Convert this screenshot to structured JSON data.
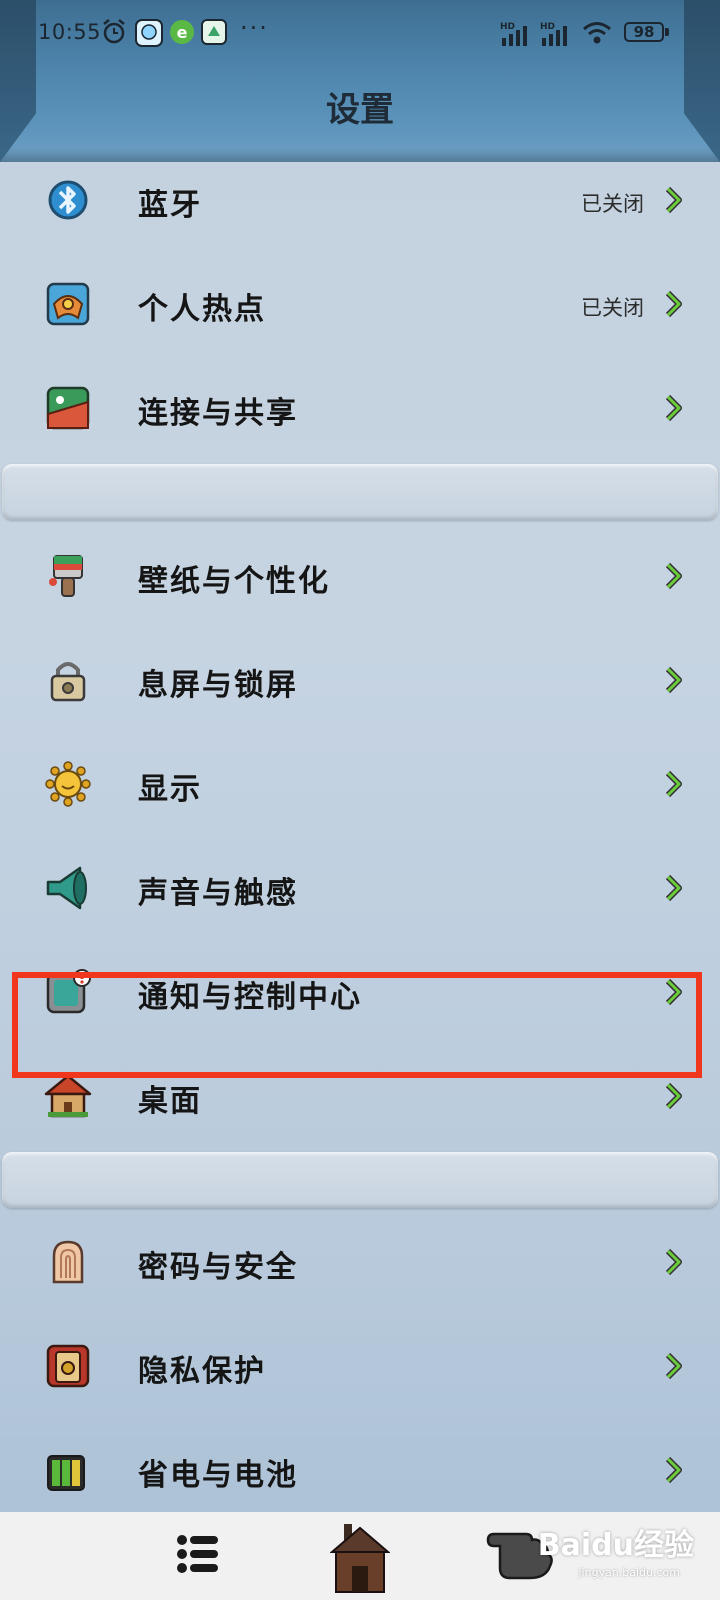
{
  "status_bar": {
    "time": "10:55",
    "icons": [
      "alarm-icon",
      "chat-app-icon",
      "e-app-icon",
      "app-notification-icon"
    ],
    "more": "···",
    "signal_1_label": "HD",
    "signal_2_label": "HD",
    "battery": "98"
  },
  "header": {
    "title": "设置"
  },
  "rows": [
    {
      "label": "蓝牙",
      "status": "已关闭",
      "icon": "bluetooth-icon"
    },
    {
      "label": "个人热点",
      "status": "已关闭",
      "icon": "hotspot-icon"
    },
    {
      "label": "连接与共享",
      "status": "",
      "icon": "connection-share-icon"
    },
    {
      "label": "壁纸与个性化",
      "status": "",
      "icon": "paintbrush-icon"
    },
    {
      "label": "息屏与锁屏",
      "status": "",
      "icon": "padlock-icon"
    },
    {
      "label": "显示",
      "status": "",
      "icon": "sun-icon"
    },
    {
      "label": "声音与触感",
      "status": "",
      "icon": "speaker-icon"
    },
    {
      "label": "通知与控制中心",
      "status": "",
      "icon": "notification-icon"
    },
    {
      "label": "桌面",
      "status": "",
      "icon": "house-icon"
    },
    {
      "label": "密码与安全",
      "status": "",
      "icon": "fingerprint-icon"
    },
    {
      "label": "隐私保护",
      "status": "",
      "icon": "privacy-lock-icon"
    },
    {
      "label": "省电与电池",
      "status": "",
      "icon": "battery-icon"
    }
  ],
  "bottom_nav": {
    "items": [
      "list-menu-icon",
      "home-hut-icon",
      "pointing-hand-icon"
    ]
  },
  "watermark": {
    "brand": "Baidu经验",
    "url": "jingyan.baidu.com"
  },
  "colors": {
    "header": "#4f86ae",
    "background": "#c4d2df",
    "chevron": "#5aa832",
    "highlight": "#f0371e"
  }
}
